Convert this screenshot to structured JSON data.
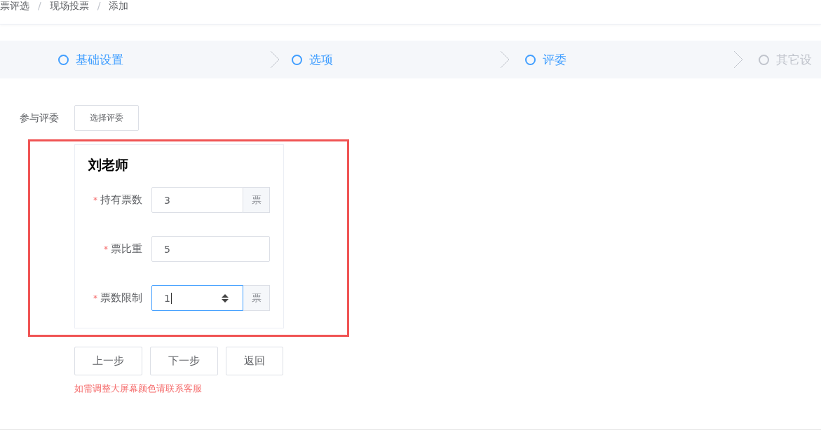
{
  "breadcrumb": [
    {
      "kind": "item",
      "text": "票评选"
    },
    {
      "kind": "separator",
      "text": "/"
    },
    {
      "kind": "item",
      "text": "现场投票"
    },
    {
      "kind": "separator",
      "text": "/"
    },
    {
      "kind": "item",
      "text": "添加"
    }
  ],
  "steps": [
    {
      "label": "基础设置",
      "active": true
    },
    {
      "label": "选项",
      "active": true
    },
    {
      "label": "评委",
      "active": true
    },
    {
      "label": "其它设",
      "active": false
    }
  ],
  "judges_field": {
    "label": "参与评委",
    "button": "选择评委"
  },
  "judge_card": {
    "name": "刘老师",
    "fields": [
      {
        "label": "持有票数",
        "required_mark": "*",
        "value": "3",
        "suffix": "票",
        "focused": false
      },
      {
        "label": "票比重",
        "required_mark": "*",
        "value": "5",
        "focused": false
      },
      {
        "label": "票数限制",
        "required_mark": "*",
        "value": "1",
        "suffix": "票",
        "focused": true
      }
    ]
  },
  "buttons": [
    "上一步",
    "下一步",
    "返回"
  ],
  "note": "如需调整大屏幕颜色请联系客服"
}
